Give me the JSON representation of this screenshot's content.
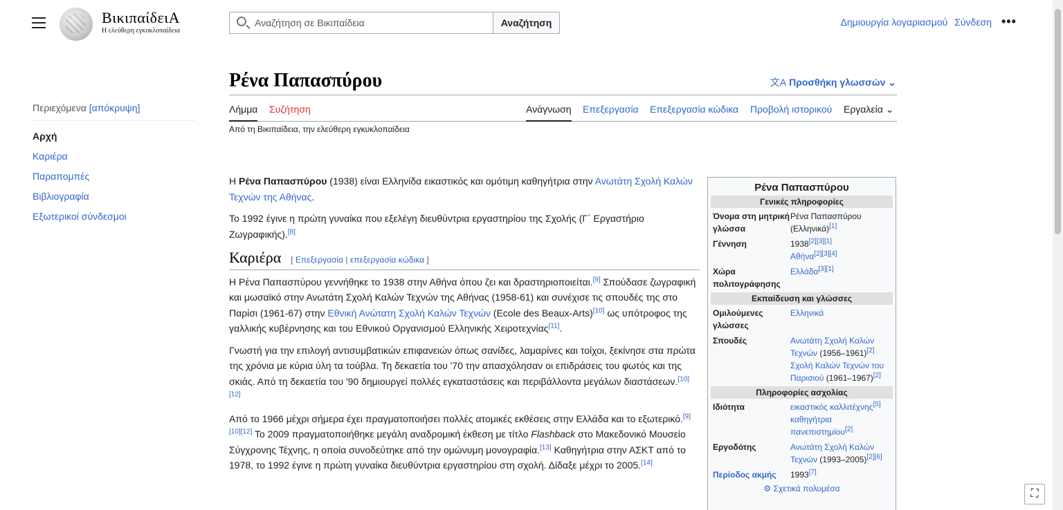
{
  "header": {
    "wordmark": "ΒικιπαίδειΑ",
    "tagline": "Η ελεύθερη εγκυκλοπαίδεια",
    "search_placeholder": "Αναζήτηση σε Βικιπαίδεια",
    "search_button": "Αναζήτηση",
    "create_account": "Δημιουργία λογαριασμού",
    "login": "Σύνδεση",
    "more": "•••"
  },
  "toc": {
    "heading": "Περιεχόμενα",
    "hide": "[απόκρυψη]",
    "items": [
      "Αρχή",
      "Καριέρα",
      "Παραπομπές",
      "Βιβλιογραφία",
      "Εξωτερικοί σύνδεσμοι"
    ]
  },
  "page": {
    "title": "Ρένα Παπασπύρου",
    "add_languages": "Προσθήκη γλωσσών",
    "lang_icon": "文A",
    "tabs": {
      "article": "Λήμμα",
      "talk": "Συζήτηση",
      "read": "Ανάγνωση",
      "edit": "Επεξεργασία",
      "edit_source": "Επεξεργασία κώδικα",
      "history": "Προβολή ιστορικού",
      "tools": "Εργαλεία"
    },
    "subtitle": "Από τη Βικιπαίδεια, την ελεύθερη εγκυκλοπαίδεια"
  },
  "article": {
    "intro1_a": "Η ",
    "intro1_name": "Ρένα Παπασπύρου",
    "intro1_b": " (1938) είναι Ελληνίδα εικαστικός και ομότιμη καθηγήτρια στην ",
    "intro1_link": "Ανωτάτη Σχολή Καλών Τεχνών της Αθήνας",
    "intro1_c": ".",
    "intro2": "Το 1992 έγινε η πρώτη γυναίκα που εξελέγη διευθύντρια εργαστηρίου της Σχολής (Γ΄ Εργαστήριο Ζωγραφικής).",
    "intro2_ref": "[8]",
    "section_title": "Καριέρα",
    "section_edit_open": "[ ",
    "section_edit": "Επεξεργασία",
    "section_sep": " | ",
    "section_edit_source": "επεξεργασία κώδικα",
    "section_edit_close": " ]",
    "c1_a": "Η Ρένα Παπασπύρου γεννήθηκε το 1938 στην Αθήνα όπου ζει και δραστηριοποιείται.",
    "c1_ref1": "[9]",
    "c1_b": " Σπούδασε ζωγραφική και μωσαϊκό στην Ανωτάτη Σχολή Καλών Τεχνών της Αθήνας (1958-61) και συνέχισε τις σπουδές της στο Παρίσι (1961-67) στην ",
    "c1_link": "Εθνική Ανώτατη Σχολή Καλών Τεχνών",
    "c1_c": " (Ecole des Beaux-Arts)",
    "c1_ref2": "[10]",
    "c1_d": " ως υπότροφος της γαλλικής κυβέρνησης και του Εθνικού Οργανισμού Ελληνικής Χειροτεχνίας",
    "c1_ref3": "[11]",
    "c1_e": ".",
    "c2": "Γνωστή για την επιλογή αντισυμβατικών επιφανειών όπως σανίδες, λαμαρίνες και τοίχοι, ξεκίνησε στα πρώτα της χρόνια με κύρια ύλη τα τούβλα. Τη δεκαετία του '70 την απασχόλησαν οι επιδράσεις του φωτός και της σκιάς. Από τη δεκαετία του '90 δημιουργεί πολλές εγκαταστάσεις και περιβάλλοντα μεγάλων διαστάσεων.",
    "c2_ref": "[10][12]",
    "c3_a": "Από το 1966 μέχρι σήμερα έχει πραγματοποιήσει πολλές ατομικές εκθέσεις στην Ελλάδα και το εξωτερικό.",
    "c3_ref1": "[9][10][12]",
    "c3_b": " Το 2009 πραγματοποιήθηκε μεγάλη αναδρομική έκθεση με τίτλο ",
    "c3_italic": "Flashback",
    "c3_c": " στο Μακεδονικό Μουσείο Σύγχρονης Τέχνης, η οποία συνοδεύτηκε από την ομώνυμη μονογραφία.",
    "c3_ref2": "[13]",
    "c3_d": " Καθηγήτρια στην ΑΣΚΤ από το 1978, το 1992 έγινε η πρώτη γυναίκα διευθύντρια εργαστηρίου στη σχολή. Δίδαξε μέχρι το 2005.",
    "c3_ref3": "[14]"
  },
  "infobox": {
    "title": "Ρένα Παπασπύρου",
    "h_general": "Γενικές πληροφορίες",
    "native_name_label": "Όνομα στη μητρική γλώσσα",
    "native_name_value": "Ρένα Παπασπύρου (Ελληνικά)",
    "native_name_ref": "[1]",
    "birth_label": "Γέννηση",
    "birth_year": "1938",
    "birth_year_ref": "[2][3][1]",
    "birth_place": "Αθήνα",
    "birth_place_ref": "[2][3][4]",
    "country_label": "Χώρα πολιτογράφησης",
    "country_value": "Ελλάδα",
    "country_ref": "[3][1]",
    "h_education": "Εκπαίδευση και γλώσσες",
    "languages_label": "Ομιλούμενες γλώσσες",
    "languages_value": "Ελληνικά",
    "studies_label": "Σπουδές",
    "studies_1": "Ανωτάτη Σχολή Καλών Τεχνών",
    "studies_1_years": " (1956–1961)",
    "studies_1_ref": "[2]",
    "studies_2": "Σχολή Καλών Τεχνών του Παρισιού",
    "studies_2_years": " (1961–1967)",
    "studies_2_ref": "[2]",
    "h_occupation": "Πληροφορίες ασχολίας",
    "occupation_label": "Ιδιότητα",
    "occupation_1": "εικαστικός καλλιτέχνης",
    "occupation_1_ref": "[5]",
    "occupation_2": "καθηγήτρια πανεπιστημίου",
    "occupation_2_ref": "[2]",
    "employer_label": "Εργοδότης",
    "employer_value": "Ανωτάτη Σχολή Καλών Τεχνών",
    "employer_years": " (1993–2005)",
    "employer_ref": "[2][6]",
    "floruit_label": "Περίοδος ακμής",
    "floruit_value": "1993",
    "floruit_ref": "[7]",
    "media": "Σχετικά πολυμέσα"
  }
}
